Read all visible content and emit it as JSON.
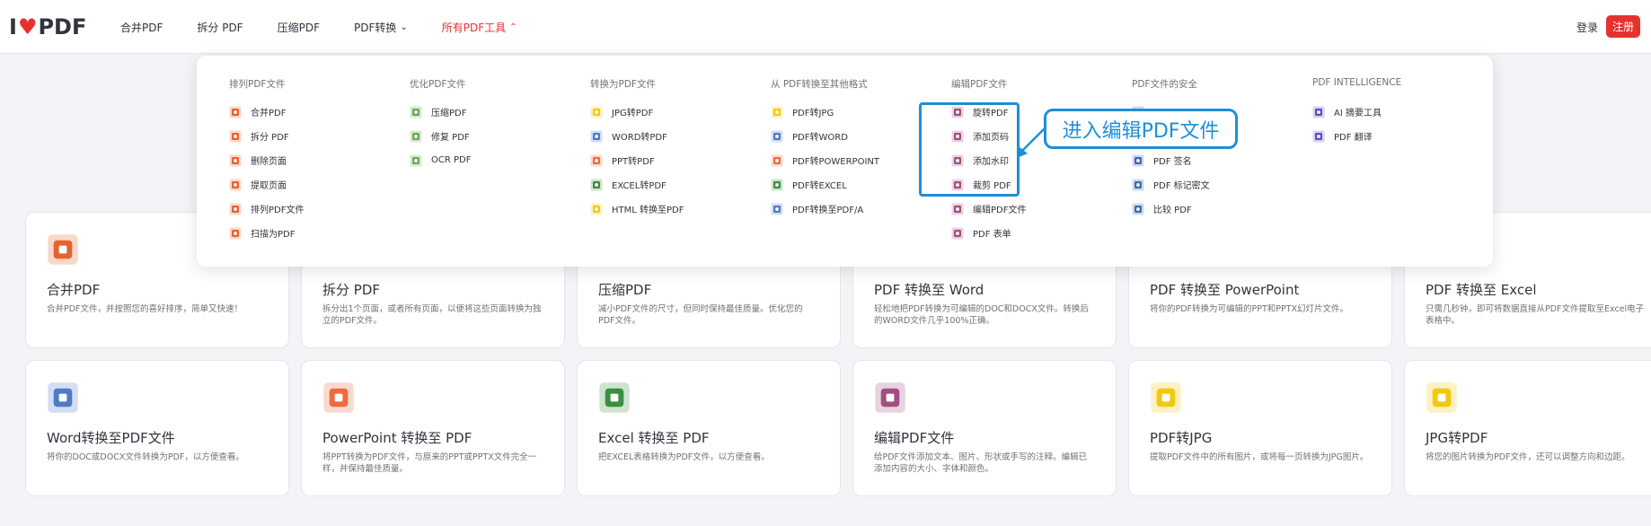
{
  "header": {
    "logo": {
      "pre": "I",
      "post": "PDF"
    },
    "nav": [
      {
        "label": "合并PDF",
        "chev": ""
      },
      {
        "label": "拆分 PDF",
        "chev": ""
      },
      {
        "label": "压缩PDF",
        "chev": ""
      },
      {
        "label": "PDF转换",
        "chev": "⌄"
      },
      {
        "label": "所有PDF工具",
        "chev": "⌃"
      }
    ],
    "login": "登录",
    "signup": "注册"
  },
  "menu": {
    "columns": [
      {
        "title": "排列PDF文件",
        "items": [
          {
            "label": "合并PDF",
            "icon": "merge-icon"
          },
          {
            "label": "拆分 PDF",
            "icon": "split-icon"
          },
          {
            "label": "删除页面",
            "icon": "delete-pages-icon"
          },
          {
            "label": "提取页面",
            "icon": "extract-pages-icon"
          },
          {
            "label": "排列PDF文件",
            "icon": "organize-icon"
          },
          {
            "label": "扫描为PDF",
            "icon": "scan-icon"
          }
        ]
      },
      {
        "title": "优化PDF文件",
        "items": [
          {
            "label": "压缩PDF",
            "icon": "compress-icon"
          },
          {
            "label": "修复 PDF",
            "icon": "repair-icon"
          },
          {
            "label": "OCR PDF",
            "icon": "ocr-icon"
          }
        ]
      },
      {
        "title": "转换为PDF文件",
        "items": [
          {
            "label": "JPG转PDF",
            "icon": "jpg-icon"
          },
          {
            "label": "WORD转PDF",
            "icon": "word-icon"
          },
          {
            "label": "PPT转PDF",
            "icon": "ppt-icon"
          },
          {
            "label": "EXCEL转PDF",
            "icon": "excel-icon"
          },
          {
            "label": "HTML 转换至PDF",
            "icon": "html-icon"
          }
        ]
      },
      {
        "title": "从 PDF转换至其他格式",
        "items": [
          {
            "label": "PDF转JPG",
            "icon": "pdf-jpg-icon"
          },
          {
            "label": "PDF转WORD",
            "icon": "pdf-word-icon"
          },
          {
            "label": "PDF转POWERPOINT",
            "icon": "pdf-ppt-icon"
          },
          {
            "label": "PDF转EXCEL",
            "icon": "pdf-excel-icon"
          },
          {
            "label": "PDF转换至PDF/A",
            "icon": "pdfa-icon"
          }
        ]
      },
      {
        "title": "编辑PDF文件",
        "items": [
          {
            "label": "旋转PDF",
            "icon": "rotate-icon"
          },
          {
            "label": "添加页码",
            "icon": "page-numbers-icon"
          },
          {
            "label": "添加水印",
            "icon": "watermark-icon"
          },
          {
            "label": "裁剪 PDF",
            "icon": "crop-icon"
          },
          {
            "label": "编辑PDF文件",
            "icon": "edit-icon"
          },
          {
            "label": "PDF 表单",
            "icon": "form-icon"
          }
        ]
      },
      {
        "title": "PDF文件的安全",
        "items": [
          {
            "label": "",
            "icon": "unlock-icon"
          },
          {
            "label": "",
            "icon": "protect-icon"
          },
          {
            "label": "PDF 签名",
            "icon": "sign-icon"
          },
          {
            "label": "PDF 标记密文",
            "icon": "redact-icon"
          },
          {
            "label": "比较 PDF",
            "icon": "compare-icon"
          }
        ]
      },
      {
        "title": "PDF INTELLIGENCE",
        "items": [
          {
            "label": "AI 摘要工具",
            "icon": "ai-summary-icon"
          },
          {
            "label": "PDF 翻译",
            "icon": "translate-icon"
          }
        ]
      }
    ]
  },
  "annotation": {
    "callout": "进入编辑PDF文件"
  },
  "cards": [
    {
      "title": "合并PDF",
      "desc": "合并PDF文件，并按照您的喜好排序，简单又快速！",
      "icon": "merge-icon"
    },
    {
      "title": "拆分 PDF",
      "desc": "拆分出1个页面，或者所有页面，以便将这些页面转换为独立的PDF文件。",
      "icon": "split-icon"
    },
    {
      "title": "压缩PDF",
      "desc": "减小PDF文件的尺寸，但同时保持最佳质量。优化您的PDF文件。",
      "icon": "compress-icon"
    },
    {
      "title": "PDF 转换至 Word",
      "desc": "轻松地把PDF转换为可编辑的DOC和DOCX文件。转换后的WORD文件几乎100%正确。",
      "icon": "pdf-word-icon"
    },
    {
      "title": "PDF 转换至 PowerPoint",
      "desc": "将你的PDF转换为可编辑的PPT和PPTX幻灯片文件。",
      "icon": "pdf-ppt-icon"
    },
    {
      "title": "PDF 转换至 Excel",
      "desc": "只需几秒钟，即可将数据直接从PDF文件提取至Excel电子表格中。",
      "icon": "pdf-excel-icon"
    },
    {
      "title": "Word转换至PDF文件",
      "desc": "将你的DOC或DOCX文件转换为PDF，以方便查看。",
      "icon": "word-icon"
    },
    {
      "title": "PowerPoint 转换至 PDF",
      "desc": "将PPT转换为PDF文件，与原来的PPT或PPTX文件完全一样，并保持最佳质量。",
      "icon": "ppt-icon"
    },
    {
      "title": "Excel 转换至 PDF",
      "desc": "把EXCEL表格转换为PDF文件，以方便查看。",
      "icon": "excel-icon"
    },
    {
      "title": "编辑PDF文件",
      "desc": "给PDF文件添加文本、图片、形状或手写的注释。编辑已添加内容的大小、字体和颜色。",
      "icon": "edit-icon"
    },
    {
      "title": "PDF转JPG",
      "desc": "提取PDF文件中的所有图片，或将每一页转换为JPG图片。",
      "icon": "pdf-jpg-icon"
    },
    {
      "title": "JPG转PDF",
      "desc": "将您的图片转换为PDF文件，还可以调整方向和边距。",
      "icon": "jpg-icon"
    }
  ],
  "icon_colors": {
    "merge-icon": "#e5632d",
    "split-icon": "#e5632d",
    "delete-pages-icon": "#e5632d",
    "extract-pages-icon": "#e5632d",
    "organize-icon": "#e5632d",
    "scan-icon": "#e5632d",
    "compress-icon": "#6aa84f",
    "repair-icon": "#6aa84f",
    "ocr-icon": "#6aa84f",
    "jpg-icon": "#f2c811",
    "word-icon": "#4f7ac7",
    "ppt-icon": "#ed6b3f",
    "excel-icon": "#3e8e41",
    "html-icon": "#f2c811",
    "pdf-jpg-icon": "#f2c811",
    "pdf-word-icon": "#4f7ac7",
    "pdf-ppt-icon": "#ed6b3f",
    "pdf-excel-icon": "#3e8e41",
    "pdfa-icon": "#4f7ac7",
    "rotate-icon": "#a14f82",
    "page-numbers-icon": "#a14f82",
    "watermark-icon": "#a14f82",
    "crop-icon": "#a14f82",
    "edit-icon": "#a14f82",
    "form-icon": "#a14f82",
    "unlock-icon": "#3b6bb2",
    "protect-icon": "#3b6bb2",
    "sign-icon": "#3b6bb2",
    "redact-icon": "#3b6bb2",
    "compare-icon": "#3b6bb2",
    "ai-summary-icon": "#5b4fc7",
    "translate-icon": "#5b4fc7"
  },
  "accent": "#e5322d",
  "annotation_color": "#1d8fd8"
}
